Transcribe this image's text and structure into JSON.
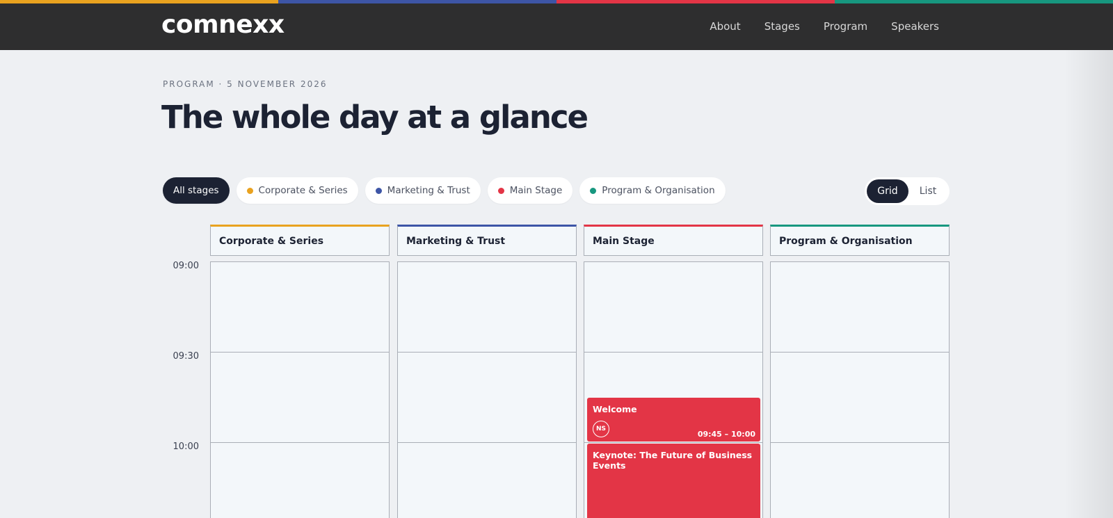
{
  "brand": {
    "logo": "comnexx"
  },
  "colors": {
    "corporate": "#e9a21f",
    "marketing": "#3d55a6",
    "main": "#e33546",
    "program": "#17977f"
  },
  "nav": {
    "items": [
      "About",
      "Stages",
      "Program",
      "Speakers"
    ]
  },
  "page": {
    "eyebrow": "PROGRAM · 5 NOVEMBER 2026",
    "title": "The whole day at a glance"
  },
  "filters": {
    "all": "All stages",
    "stages": [
      {
        "label": "Corporate & Series",
        "color": "#e9a21f"
      },
      {
        "label": "Marketing & Trust",
        "color": "#3d55a6"
      },
      {
        "label": "Main Stage",
        "color": "#e33546"
      },
      {
        "label": "Program & Organisation",
        "color": "#17977f"
      }
    ]
  },
  "view_toggle": {
    "grid": "Grid",
    "list": "List",
    "selected": "Grid"
  },
  "schedule": {
    "times": [
      "09:00",
      "09:30",
      "10:00"
    ],
    "columns": [
      {
        "name": "Corporate & Series",
        "color": "#e9a21f"
      },
      {
        "name": "Marketing & Trust",
        "color": "#3d55a6"
      },
      {
        "name": "Main Stage",
        "color": "#e33546"
      },
      {
        "name": "Program & Organisation",
        "color": "#17977f"
      }
    ],
    "events": [
      {
        "title": "Welcome",
        "speaker_initials": "NS",
        "time": "09:45 – 10:00"
      },
      {
        "title": "Keynote: The Future of Business Events"
      }
    ]
  }
}
